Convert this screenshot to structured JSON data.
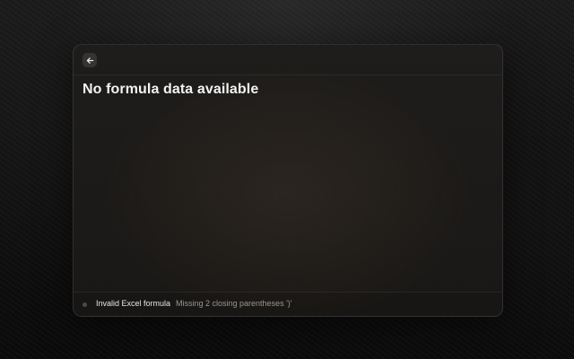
{
  "window": {
    "back_icon": "arrow-left-icon",
    "title": "No formula data available"
  },
  "status": {
    "indicator": "status-dot-icon",
    "title": "Invalid Excel formula",
    "message": "Missing 2 closing parentheses ')'"
  },
  "colors": {
    "background": "#0b0b0b",
    "panel": "#1c1a18",
    "title_text": "#f2f2f2",
    "status_title_text": "#e6e6e6",
    "status_message_text": "#9a9691",
    "status_dot": "#4a4a4a"
  }
}
